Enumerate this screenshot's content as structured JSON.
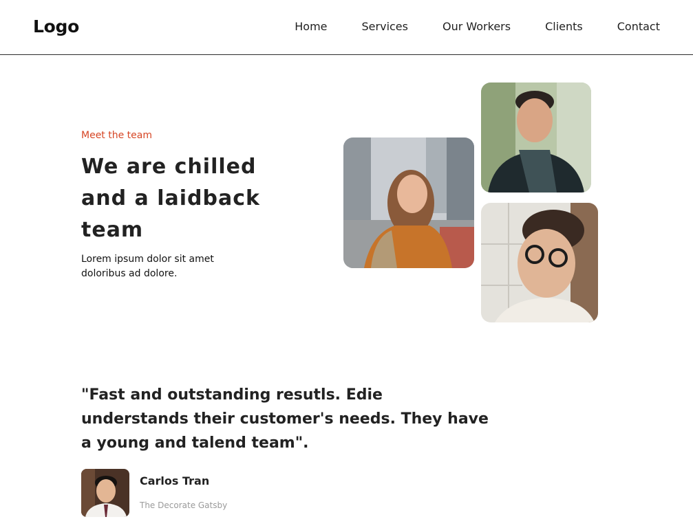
{
  "header": {
    "logo": "Logo",
    "nav": [
      "Home",
      "Services",
      "Our Workers",
      "Clients",
      "Contact"
    ]
  },
  "hero": {
    "eyebrow": "Meet the team",
    "title": "We are chilled and a laidback team",
    "description": "Lorem ipsum dolor sit amet doloribus ad dolore."
  },
  "testimonial": {
    "quote": "\"Fast and outstanding resutls. Edie understands their customer's needs. They have a young and talend team\".",
    "author_name": "Carlos Tran",
    "author_company": "The Decorate Gatsby"
  },
  "colors": {
    "accent": "#d64524",
    "text": "#222222",
    "muted": "#9a9a9a"
  }
}
